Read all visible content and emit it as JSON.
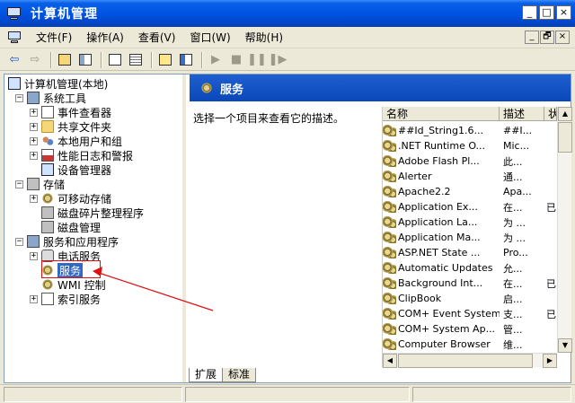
{
  "window": {
    "title": "计算机管理"
  },
  "titlebar_buttons": [
    "_",
    "□",
    "×"
  ],
  "menu": {
    "items": [
      "文件(F)",
      "操作(A)",
      "查看(V)",
      "窗口(W)",
      "帮助(H)"
    ]
  },
  "mdi_buttons": [
    "_",
    "🗗",
    "×"
  ],
  "tree": {
    "root": "计算机管理(本地)",
    "system_tools": "系统工具",
    "event_viewer": "事件查看器",
    "shared_folders": "共享文件夹",
    "local_users": "本地用户和组",
    "perf_logs": "性能日志和警报",
    "device_manager": "设备管理器",
    "storage": "存储",
    "removable_storage": "可移动存储",
    "defrag": "磁盘碎片整理程序",
    "disk_mgmt": "磁盘管理",
    "services_apps": "服务和应用程序",
    "telephony": "电话服务",
    "services": "服务",
    "wmi": "WMI 控制",
    "indexing": "索引服务"
  },
  "right": {
    "header": "服务",
    "description": "选择一个项目来查看它的描述。"
  },
  "list": {
    "columns": [
      "名称",
      "描述",
      "状"
    ],
    "rows": [
      {
        "name": "##Id_String1.6...",
        "desc": "##I...",
        "status": ""
      },
      {
        "name": ".NET Runtime O...",
        "desc": "Mic...",
        "status": ""
      },
      {
        "name": "Adobe Flash Pl...",
        "desc": "此...",
        "status": ""
      },
      {
        "name": "Alerter",
        "desc": "通...",
        "status": ""
      },
      {
        "name": "Apache2.2",
        "desc": "Apa...",
        "status": ""
      },
      {
        "name": "Application Ex...",
        "desc": "在...",
        "status": "已"
      },
      {
        "name": "Application La...",
        "desc": "为 ...",
        "status": ""
      },
      {
        "name": "Application Ma...",
        "desc": "为 ...",
        "status": ""
      },
      {
        "name": "ASP.NET State ...",
        "desc": "Pro...",
        "status": ""
      },
      {
        "name": "Automatic Updates",
        "desc": "允...",
        "status": ""
      },
      {
        "name": "Background Int...",
        "desc": "在...",
        "status": "已"
      },
      {
        "name": "ClipBook",
        "desc": "启...",
        "status": ""
      },
      {
        "name": "COM+ Event System",
        "desc": "支...",
        "status": "已"
      },
      {
        "name": "COM+ System Ap...",
        "desc": "管...",
        "status": ""
      },
      {
        "name": "Computer Browser",
        "desc": "维...",
        "status": ""
      }
    ]
  },
  "tabs": [
    "扩展",
    "标准"
  ],
  "colors": {
    "title_blue": "#0054E3",
    "selection": "#316AC5",
    "annotation_red": "#E01010"
  }
}
